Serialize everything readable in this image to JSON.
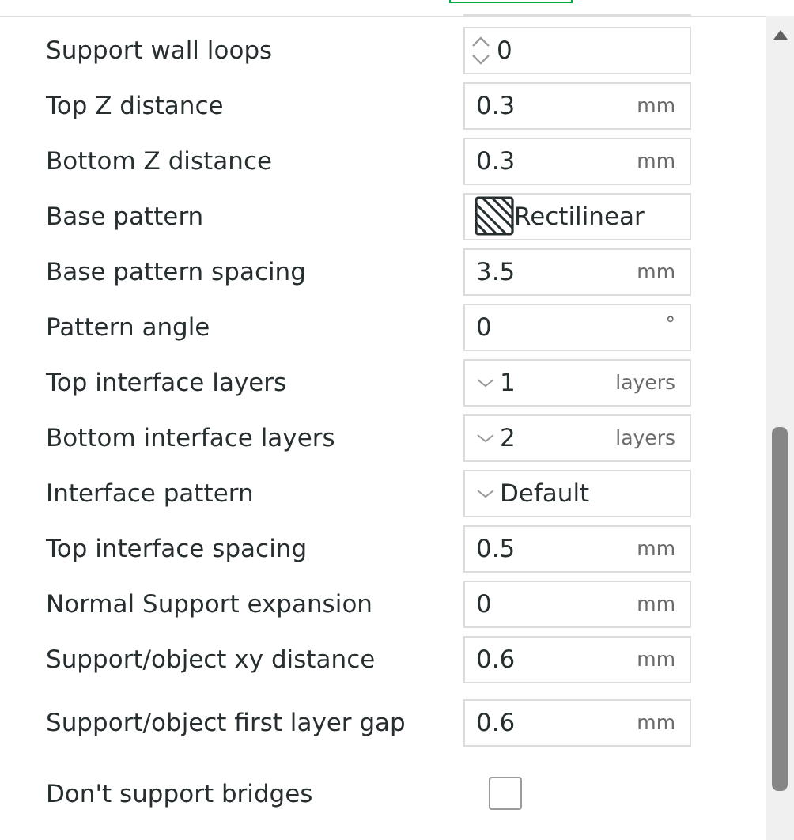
{
  "settings": [
    {
      "label": "Support wall loops",
      "kind": "spin",
      "value": "0"
    },
    {
      "label": "Top Z distance",
      "kind": "number",
      "value": "0.3",
      "unit": "mm"
    },
    {
      "label": "Bottom Z distance",
      "kind": "number",
      "value": "0.3",
      "unit": "mm"
    },
    {
      "label": "Base pattern",
      "kind": "pattern",
      "value": "Rectilinear"
    },
    {
      "label": "Base pattern spacing",
      "kind": "number",
      "value": "3.5",
      "unit": "mm"
    },
    {
      "label": "Pattern angle",
      "kind": "number",
      "value": "0",
      "unit": "°"
    },
    {
      "label": "Top interface layers",
      "kind": "combo",
      "value": "1",
      "unit": "layers"
    },
    {
      "label": "Bottom interface layers",
      "kind": "combo",
      "value": "2",
      "unit": "layers"
    },
    {
      "label": "Interface pattern",
      "kind": "combo",
      "value": "Default"
    },
    {
      "label": "Top interface spacing",
      "kind": "number",
      "value": "0.5",
      "unit": "mm"
    },
    {
      "label": "Normal Support expansion",
      "kind": "number",
      "value": "0",
      "unit": "mm"
    },
    {
      "label": "Support/object xy distance",
      "kind": "number",
      "value": "0.6",
      "unit": "mm"
    },
    {
      "label": "Support/object first layer gap",
      "kind": "number",
      "value": "0.6",
      "unit": "mm"
    },
    {
      "label": "Don't support bridges",
      "kind": "checkbox",
      "checked": false
    }
  ]
}
